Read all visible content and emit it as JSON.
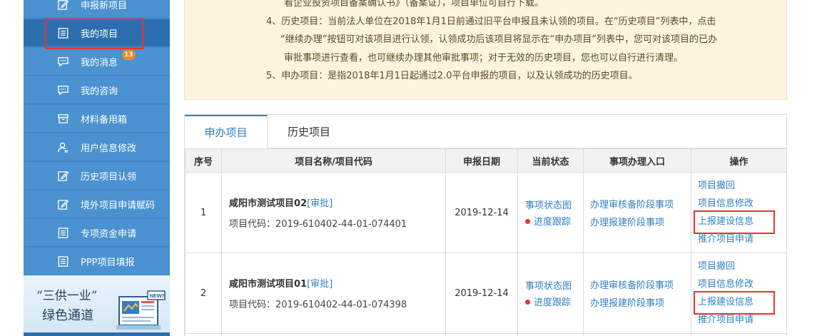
{
  "sidebar": {
    "items": [
      {
        "label": "申报新项目",
        "icon": "edit-icon"
      },
      {
        "label": "我的项目",
        "icon": "list-icon",
        "active": true
      },
      {
        "label": "我的消息",
        "icon": "chat-icon",
        "badge": "13"
      },
      {
        "label": "我的咨询",
        "icon": "chat-icon"
      },
      {
        "label": "材料备用箱",
        "icon": "archive-box-icon"
      },
      {
        "label": "用户信息修改",
        "icon": "user-icon"
      },
      {
        "label": "历史项目认领",
        "icon": "edit-icon"
      },
      {
        "label": "境外项目申请赋码",
        "icon": "edit-icon"
      },
      {
        "label": "专项资金申请",
        "icon": "list-icon"
      },
      {
        "label": "PPP项目填报",
        "icon": "list-icon"
      }
    ],
    "promo": {
      "line1": "“三供一业”",
      "line2": "绿色通道",
      "art_text": "NEWS"
    }
  },
  "notice": {
    "line0": "看企业投资项目备案确认书》（备案证），项目单位可自行下载。",
    "line1": "4、历史项目：当前法人单位在2018年1月1日前通过旧平台申报且未认领的项目。在“历史项目”列表中，点击",
    "line2": "“继续办理”按钮可对该项目进行认领，认领成功后该项目将显示在“申办项目”列表中，您可对该项目的已办",
    "line3": "审批事项进行查看，也可继续办理其他审批事项；对于无效的历史项目，您也可以自行进行清理。",
    "line4": "5、申办项目：是指2018年1月1日起通过2.0平台申报的项目，以及认领成功的历史项目。"
  },
  "tabs": [
    {
      "label": "申办项目",
      "active": true
    },
    {
      "label": "历史项目",
      "active": false
    }
  ],
  "table": {
    "headers": [
      "序号",
      "项目名称/项目代码",
      "申报日期",
      "当前状态",
      "事项办理入口",
      "操作"
    ],
    "rows": [
      {
        "index": "1",
        "name": "咸阳市测试项目02",
        "name_tag": "[审批]",
        "code_label": "项目代码：",
        "code": "2019-610402-44-01-074401",
        "date": "2019-12-14",
        "status_link": "事项状态图",
        "progress_link": "进度跟踪",
        "entry1": "办理审核备阶段事项",
        "entry2": "办理报建阶段事项",
        "ops": [
          "项目撤回",
          "项目信息修改",
          "上报建设信息",
          "推介项目申请"
        ]
      },
      {
        "index": "2",
        "name": "咸阳市测试项目01",
        "name_tag": "[审批]",
        "code_label": "项目代码：",
        "code": "2019-610402-44-01-074398",
        "date": "2019-12-14",
        "status_link": "事项状态图",
        "progress_link": "进度跟踪",
        "entry1": "办理审核备阶段事项",
        "entry2": "办理报建阶段事项",
        "ops": [
          "项目撤回",
          "项目信息修改",
          "上报建设信息",
          "推介项目申请"
        ]
      }
    ]
  },
  "colors": {
    "sidebar_bg": "#4a92d0",
    "sidebar_active": "#2d6fae",
    "link_blue": "#2f7fc4",
    "highlight_red": "#e8322e",
    "notice_bg": "#fcf4df",
    "badge_orange": "#f08a24"
  }
}
